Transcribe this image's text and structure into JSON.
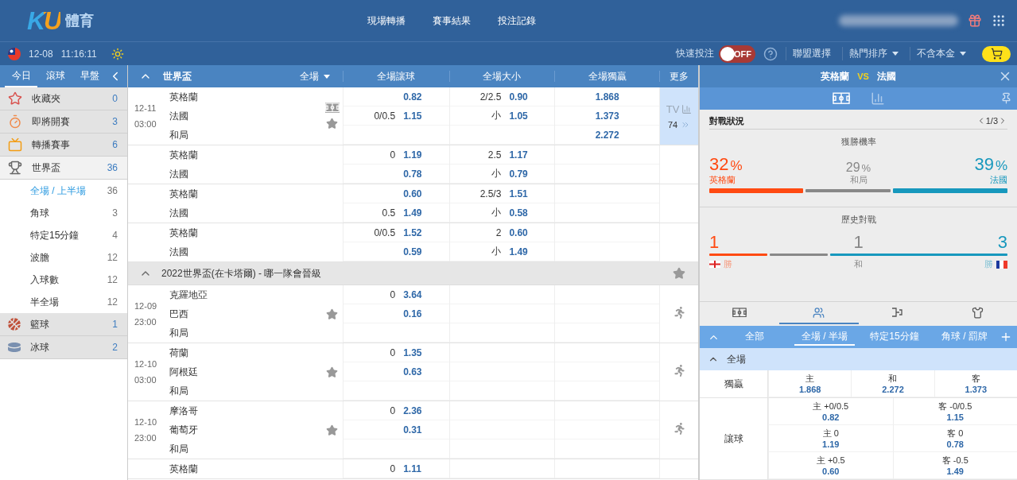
{
  "header": {
    "logo": {
      "mark": "KU",
      "text": "體育"
    },
    "nav": [
      "現場轉播",
      "賽事結果",
      "投注記錄"
    ]
  },
  "subbar": {
    "date": "12-08",
    "time": "11:16:11",
    "quick_bet": {
      "label": "快速投注",
      "toggle_text": "OFF",
      "on": false
    },
    "menus": [
      {
        "label": "聯盟選擇",
        "dropdown": false
      },
      {
        "label": "熱門排序",
        "dropdown": true
      },
      {
        "label": "不含本金",
        "dropdown": true
      }
    ]
  },
  "sidebar": {
    "tabs": [
      {
        "label": "今日",
        "selected": true
      },
      {
        "label": "滾球",
        "selected": false
      },
      {
        "label": "早盤",
        "selected": false
      }
    ],
    "items": [
      {
        "kind": "star",
        "label": "收藏夾",
        "count": "0"
      },
      {
        "kind": "clock",
        "label": "即將開賽",
        "count": "3"
      },
      {
        "kind": "tv",
        "label": "轉播賽事",
        "count": "6"
      },
      {
        "kind": "trophy",
        "label": "世界盃",
        "count": "36",
        "expanded": true,
        "children": [
          {
            "label": "全場 / 上半場",
            "count": "36",
            "selected": true
          },
          {
            "label": "角球",
            "count": "3",
            "selected": false
          },
          {
            "label": "特定15分鐘",
            "count": "4",
            "selected": false
          },
          {
            "label": "波膽",
            "count": "12",
            "selected": false
          },
          {
            "label": "入球數",
            "count": "12",
            "selected": false
          },
          {
            "label": "半全場",
            "count": "12",
            "selected": false
          }
        ]
      },
      {
        "kind": "basketball",
        "label": "籃球",
        "count": "1"
      },
      {
        "kind": "hockey",
        "label": "冰球",
        "count": "2"
      }
    ]
  },
  "table": {
    "league": "世界盃",
    "filter": "全場",
    "columns": [
      "全場讓球",
      "全場大小",
      "全場獨贏",
      "更多"
    ],
    "rows": [
      {
        "kind": "match",
        "date": "12-11",
        "time": "03:00",
        "field_icon": true,
        "star": true,
        "more": {
          "tv": "TV",
          "count": "74"
        },
        "lines": [
          {
            "team": "英格蘭",
            "hdp_odds": "0.82",
            "ou_line": "2/2.5",
            "ou_odds": "0.90",
            "win": "1.868"
          },
          {
            "team": "法國",
            "hdp_line": "0/0.5",
            "hdp_odds": "1.15",
            "ou_line": "小",
            "ou_odds": "1.05",
            "win": "1.373"
          },
          {
            "team": "和局",
            "win": "2.272"
          }
        ]
      },
      {
        "kind": "match",
        "lines": [
          {
            "team": "英格蘭",
            "hdp_line": "0",
            "hdp_odds": "1.19",
            "ou_line": "2.5",
            "ou_odds": "1.17"
          },
          {
            "team": "法國",
            "hdp_odds": "0.78",
            "ou_line": "小",
            "ou_odds": "0.79"
          }
        ]
      },
      {
        "kind": "match",
        "lines": [
          {
            "team": "英格蘭",
            "hdp_odds": "0.60",
            "ou_line": "2.5/3",
            "ou_odds": "1.51"
          },
          {
            "team": "法國",
            "hdp_line": "0.5",
            "hdp_odds": "1.49",
            "ou_line": "小",
            "ou_odds": "0.58"
          }
        ]
      },
      {
        "kind": "match",
        "lines": [
          {
            "team": "英格蘭",
            "hdp_line": "0/0.5",
            "hdp_odds": "1.52",
            "ou_line": "2",
            "ou_odds": "0.60"
          },
          {
            "team": "法國",
            "hdp_odds": "0.59",
            "ou_line": "小",
            "ou_odds": "1.49"
          }
        ]
      },
      {
        "kind": "league",
        "title": "2022世界盃(在卡塔爾) - 哪一隊會晉級",
        "star": true
      },
      {
        "kind": "match",
        "date": "12-09",
        "time": "23:00",
        "star": true,
        "runner": true,
        "lines": [
          {
            "team": "克羅地亞",
            "hdp_line": "0",
            "hdp_odds": "3.64"
          },
          {
            "team": "巴西",
            "hdp_odds": "0.16"
          },
          {
            "team": "和局"
          }
        ]
      },
      {
        "kind": "match",
        "date": "12-10",
        "time": "03:00",
        "star": true,
        "runner": true,
        "lines": [
          {
            "team": "荷蘭",
            "hdp_line": "0",
            "hdp_odds": "1.35"
          },
          {
            "team": "阿根廷",
            "hdp_odds": "0.63"
          },
          {
            "team": "和局"
          }
        ]
      },
      {
        "kind": "match",
        "date": "12-10",
        "time": "23:00",
        "star": true,
        "runner": true,
        "lines": [
          {
            "team": "摩洛哥",
            "hdp_line": "0",
            "hdp_odds": "2.36"
          },
          {
            "team": "葡萄牙",
            "hdp_odds": "0.31"
          },
          {
            "team": "和局"
          }
        ]
      },
      {
        "kind": "match",
        "lines": [
          {
            "team": "英格蘭",
            "hdp_line": "0",
            "hdp_odds": "1.11"
          }
        ]
      }
    ]
  },
  "panel": {
    "home": "英格蘭",
    "vs": "VS",
    "away": "法國",
    "view_tabs": [
      {
        "kind": "field",
        "selected": true
      },
      {
        "kind": "chart",
        "selected": false
      }
    ],
    "status": {
      "title": "對戰狀況",
      "page": "1/3",
      "win_prob": {
        "title": "獲勝機率",
        "items": [
          {
            "kind": "home",
            "value": "32",
            "unit": "%",
            "label": "英格蘭"
          },
          {
            "kind": "draw",
            "value": "29",
            "unit": "%",
            "label": "和局"
          },
          {
            "kind": "away",
            "value": "39",
            "unit": "%",
            "label": "法國"
          }
        ]
      },
      "history": {
        "title": "歷史對戰",
        "items": [
          {
            "kind": "home",
            "value": "1",
            "label": "勝"
          },
          {
            "kind": "draw",
            "value": "1",
            "label": "和"
          },
          {
            "kind": "away",
            "value": "3",
            "label": "勝"
          }
        ]
      }
    },
    "icon_tabs": [
      {
        "kind": "field",
        "selected": false
      },
      {
        "kind": "people",
        "selected": true
      },
      {
        "kind": "bracket",
        "selected": false
      },
      {
        "kind": "shirt",
        "selected": false
      }
    ],
    "market_tabs": [
      {
        "label": "全部",
        "selected": false
      },
      {
        "label": "全場 / 半場",
        "selected": true
      },
      {
        "label": "特定15分鐘",
        "selected": false
      },
      {
        "label": "角球 / 罰牌",
        "selected": false
      }
    ],
    "section": "全場",
    "markets": [
      {
        "name": "獨贏",
        "rows": [
          [
            {
              "label": "主",
              "odds": "1.868"
            },
            {
              "label": "和",
              "odds": "2.272"
            },
            {
              "label": "客",
              "odds": "1.373"
            }
          ]
        ]
      },
      {
        "name": "讓球",
        "rows": [
          [
            {
              "label": "主 +0/0.5",
              "odds": "0.82"
            },
            {
              "label": "客 -0/0.5",
              "odds": "1.15"
            }
          ],
          [
            {
              "label": "主 0",
              "odds": "1.19"
            },
            {
              "label": "客 0",
              "odds": "0.78"
            }
          ],
          [
            {
              "label": "主 +0.5",
              "odds": "0.60"
            },
            {
              "label": "客 -0.5",
              "odds": "1.49"
            }
          ]
        ]
      }
    ]
  }
}
